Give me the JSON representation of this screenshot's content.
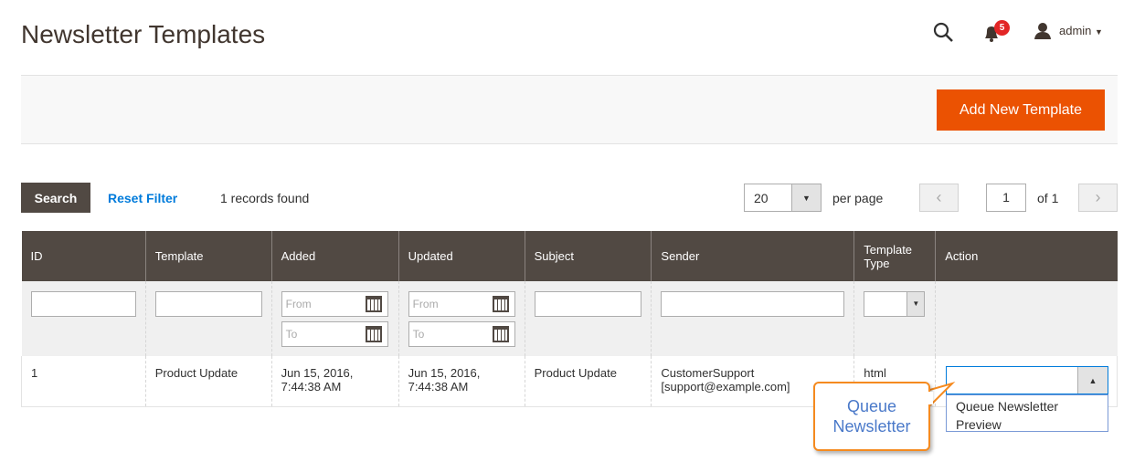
{
  "header": {
    "title": "Newsletter Templates",
    "notification_count": "5",
    "user": "admin"
  },
  "actions": {
    "add_new": "Add New Template"
  },
  "toolbar": {
    "search": "Search",
    "reset": "Reset Filter",
    "records": "1 records found",
    "per_page_value": "20",
    "per_page_label": "per page",
    "page": "1",
    "of_pages": "of 1"
  },
  "columns": [
    "ID",
    "Template",
    "Added",
    "Updated",
    "Subject",
    "Sender",
    "Template Type",
    "Action"
  ],
  "filters": {
    "from": "From",
    "to": "To"
  },
  "rows": [
    {
      "id": "1",
      "template": "Product Update",
      "added": "Jun 15, 2016, 7:44:38 AM",
      "updated": "Jun 15, 2016, 7:44:38 AM",
      "subject": "Product Update",
      "sender": "CustomerSupport [support@example.com]",
      "type": "html"
    }
  ],
  "action_menu": [
    "Queue Newsletter",
    "Preview"
  ],
  "callout": "Queue Newsletter"
}
